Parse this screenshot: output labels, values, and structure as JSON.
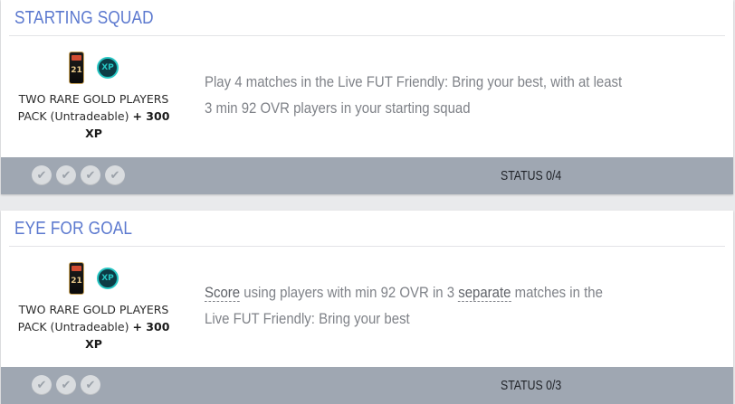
{
  "objectives": [
    {
      "title": "STARTING SQUAD",
      "reward": {
        "pack_icon": "fut-21-pack-icon",
        "pack_number": "21",
        "xp_badge": "XP",
        "pack_name": "TWO RARE GOLD PLAYERS PACK (Untradeable)",
        "xp_reward": "+ 300 XP"
      },
      "description": "Play 4 matches in the Live FUT Friendly: Bring your best, with at least 3 min 92 OVR players in your starting squad",
      "progress_steps": 4,
      "status": "STATUS 0/4"
    },
    {
      "title": "EYE FOR GOAL",
      "reward": {
        "pack_icon": "fut-21-pack-icon",
        "pack_number": "21",
        "xp_badge": "XP",
        "pack_name": "TWO RARE GOLD PLAYERS PACK (Untradeable)",
        "xp_reward": "+ 300 XP"
      },
      "description_parts": {
        "term1": "Score",
        "text1": " using players with min 92 OVR in 3 ",
        "term2": "separate",
        "text2": " matches in the Live FUT Friendly: Bring your best"
      },
      "progress_steps": 3,
      "status": "STATUS 0/3"
    }
  ],
  "colors": {
    "title": "#5c79cf",
    "footer": "#9fa7b2",
    "xp_accent": "#27c7c4"
  }
}
